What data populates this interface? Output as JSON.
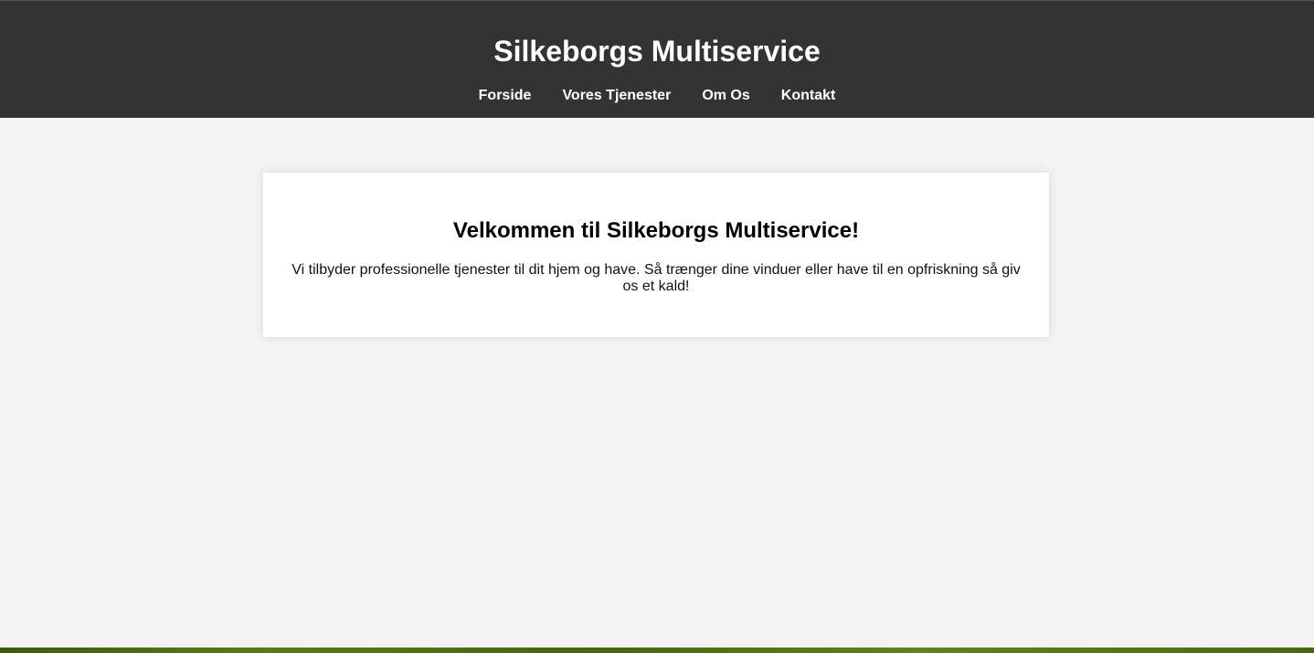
{
  "header": {
    "title": "Silkeborgs Multiservice",
    "nav": [
      {
        "label": "Forside"
      },
      {
        "label": "Vores Tjenester"
      },
      {
        "label": "Om Os"
      },
      {
        "label": "Kontakt"
      }
    ]
  },
  "main": {
    "heading": "Velkommen til Silkeborgs Multiservice!",
    "text": "Vi tilbyder professionelle tjenester til dit hjem og have. Så trænger dine vinduer eller have til en opfriskning så giv os et kald!"
  },
  "colors": {
    "header_bg": "#333333",
    "page_bg": "#f3f3f3",
    "card_bg": "#ffffff"
  }
}
